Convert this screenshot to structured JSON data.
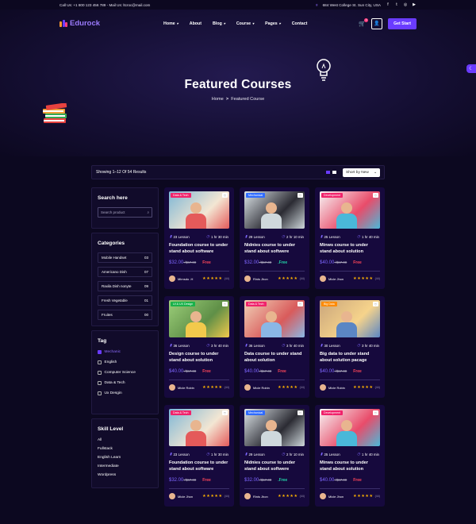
{
  "topbar": {
    "call": "Call Us: +1 800 123 456 789",
    "mail": "Mail Us: ltcroc@mail.com",
    "address": "684 West College St. Sun City, USA"
  },
  "nav": {
    "brand": "Edurock",
    "items": [
      "Home",
      "About",
      "Blog",
      "Course",
      "Pages",
      "Contact"
    ],
    "cta": "Get Start",
    "cart_count": "0"
  },
  "hero": {
    "title": "Featured Courses",
    "breadcrumb_home": "Home",
    "breadcrumb_sep": ">",
    "breadcrumb_current": "Featured Course"
  },
  "results": {
    "showing": "Showing 1–12 Of 54 Results",
    "sort": "Short by New"
  },
  "sidebar": {
    "search": {
      "title": "Search here",
      "placeholder": "Search product"
    },
    "categories": {
      "title": "Categories",
      "items": [
        {
          "name": "Mobile Handset",
          "count": "03"
        },
        {
          "name": "Americano Dish",
          "count": "07"
        },
        {
          "name": "Raxila Dish nonyte",
          "count": "09"
        },
        {
          "name": "Fresh Vegetable",
          "count": "01"
        },
        {
          "name": "Fruites",
          "count": "00"
        }
      ]
    },
    "tag": {
      "title": "Tag",
      "items": [
        "Mechanic",
        "English",
        "Computer Science",
        "Data & Tech",
        "Ux Desgin"
      ]
    },
    "skill": {
      "title": "Skill Level",
      "items": [
        "All",
        "Fullstack",
        "English Learn",
        "Intermediate",
        "Wordpress"
      ]
    }
  },
  "courses": [
    {
      "label": "Data & Tech",
      "lessons": "23 Lesson",
      "duration": "1 hr 30 min",
      "title": "Foundation course to under stand about software",
      "price": "$32.00",
      "old": "$67.00",
      "tag": "Free",
      "instructor": "Mirnsdo .H",
      "reviews": "(44)"
    },
    {
      "label": "Mechanical",
      "lessons": "29 Lesson",
      "duration": "2 hr 10 min",
      "title": "Nidnies course to under stand about softwere",
      "price": "$32.00",
      "old": "$67.00",
      "tag": ".Free",
      "instructor": "Rinis Jhon",
      "reviews": "(44)"
    },
    {
      "label": "Development",
      "lessons": "25 Lesson",
      "duration": "1 hr 40 min",
      "title": "Minws course to under stand about solution",
      "price": "$40.00",
      "old": "$67.00",
      "tag": "Free",
      "instructor": "Micle Jhon",
      "reviews": "(44)"
    },
    {
      "label": "UI & UX Design",
      "lessons": "36 Lesson",
      "duration": "3 hr 40 min",
      "title": "Design course to under stand about solution",
      "price": "$40.00",
      "old": "$67.00",
      "tag": "Free",
      "instructor": "Micle Robin",
      "reviews": "(44)"
    },
    {
      "label": "Data & Tech",
      "lessons": "36 Lesson",
      "duration": "3 hr 40 min",
      "title": "Data course to under stand about solution",
      "price": "$40.00",
      "old": "$67.00",
      "tag": "Free",
      "instructor": "Micle Robin",
      "reviews": "(44)"
    },
    {
      "label": "Big Data",
      "lessons": "30 Lesson",
      "duration": "3 hr 40 min",
      "title": "Big data to under stand about solution pacage",
      "price": "$40.00",
      "old": "$67.00",
      "tag": "Free",
      "instructor": "Micle Robin",
      "reviews": "(44)"
    },
    {
      "label": "Data & Tech",
      "lessons": "23 Lesson",
      "duration": "1 hr 30 min",
      "title": "Foundation course to under stand about software",
      "price": "$32.00",
      "old": "$67.00",
      "tag": "Free",
      "instructor": "Micle Jhon",
      "reviews": "(44)"
    },
    {
      "label": "Mechanical",
      "lessons": "29 Lesson",
      "duration": "2 hr 10 min",
      "title": "Nidnies course to under stand about softwere",
      "price": "$32.00",
      "old": "$67.00",
      "tag": ".Free",
      "instructor": "Rinis Jhon",
      "reviews": "(44)"
    },
    {
      "label": "Development",
      "lessons": "25 Lesson",
      "duration": "1 hr 40 min",
      "title": "Minws course to under stand about solution",
      "price": "$40.00",
      "old": "$67.00",
      "tag": "Free",
      "instructor": "Micle Jhon",
      "reviews": "(44)"
    }
  ],
  "colors": {
    "accent": "#6a3bff",
    "label_pink": "#f0226b",
    "label_blue": "#2f6bff",
    "label_green": "#19b24a",
    "label_orange": "#ff8a00",
    "free_red": "#ff4659",
    "free_green": "#22d3a8",
    "star": "#ffb400"
  },
  "icons": {
    "phone": "phone-icon",
    "location": "location-icon",
    "cart": "cart-icon",
    "user": "user-icon",
    "search": "search-icon",
    "lesson": "book-icon",
    "clock": "clock-icon",
    "heart": "heart-icon",
    "moon": "moon-icon"
  }
}
